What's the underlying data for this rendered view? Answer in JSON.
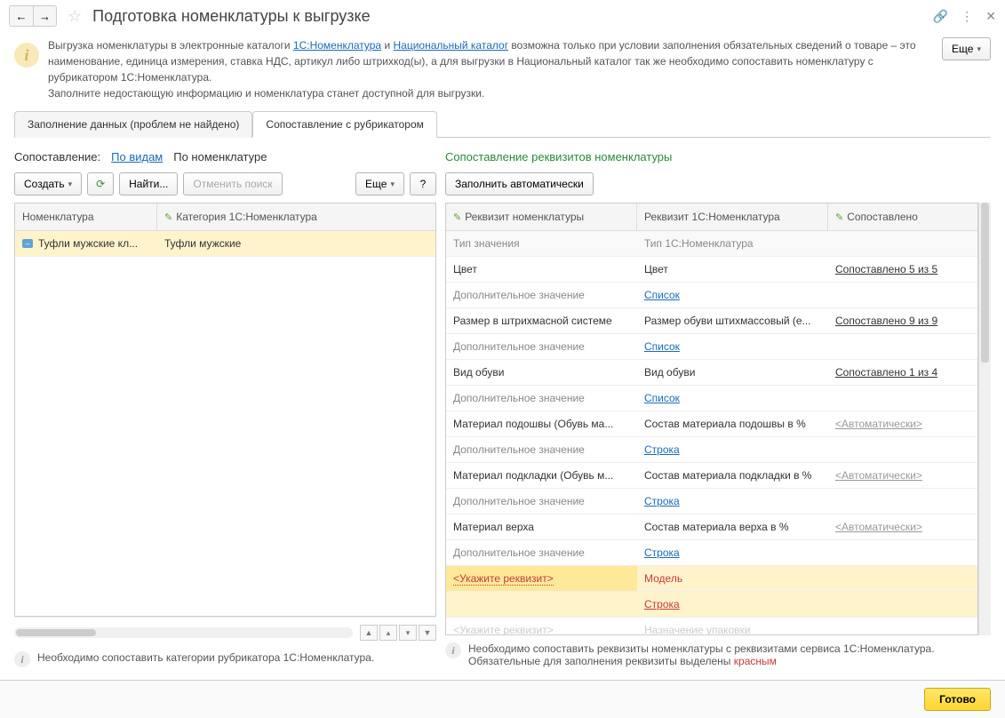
{
  "titlebar": {
    "title": "Подготовка номенклатуры к выгрузке"
  },
  "info": {
    "text_before_link1": "Выгрузка номенклатуры в электронные каталоги ",
    "link1": "1С:Номенклатура",
    "text_mid": " и ",
    "link2": "Национальный каталог",
    "text_after": " возможна только при условии заполнения обязательных сведений о товаре – это наименование, единица измерения, ставка НДС, артикул либо штрихкод(ы), а для выгрузки в Национальный каталог так же необходимо сопоставить номенклатуру с рубрикатором 1С:Номенклатура.",
    "line2": "Заполните недостающую информацию и номенклатура станет доступной для выгрузки."
  },
  "more_btn": "Еще",
  "tabs": {
    "tab1": "Заполнение данных (проблем не найдено)",
    "tab2": "Сопоставление с рубрикатором"
  },
  "left": {
    "filter_label": "Сопоставление:",
    "by_types": "По видам",
    "by_nomen": "По номенклатуре",
    "create_btn": "Создать",
    "find_btn": "Найти...",
    "cancel_search": "Отменить поиск",
    "more": "Еще",
    "help": "?",
    "header_col1": "Номенклатура",
    "header_col2": "Категория 1С:Номенклатура",
    "row1_name": "Туфли мужские кл...",
    "row1_cat": "Туфли мужские",
    "footer": "Необходимо сопоставить категории рубрикатора 1С:Номенклатура."
  },
  "right": {
    "title": "Сопоставление реквизитов номенклатуры",
    "auto_fill": "Заполнить автоматически",
    "h1": "Реквизит номенклатуры",
    "h2": "Реквизит 1С:Номенклатура",
    "h3": "Сопоставлено",
    "sub_h1": "Тип значения",
    "sub_h2": "Тип 1С:Номенклатура",
    "rows": [
      {
        "r1": "Цвет",
        "r2": "Цвет",
        "r3": "Сопоставлено 5 из 5",
        "s1": "Дополнительное значение",
        "s2": "Список",
        "link": true
      },
      {
        "r1": "Размер в штрихмасной системе",
        "r2": "Размер обуви штихмассовый (е...",
        "r3": "Сопоставлено 9 из 9",
        "s1": "Дополнительное значение",
        "s2": "Список",
        "link": true
      },
      {
        "r1": "Вид обуви",
        "r2": "Вид обуви",
        "r3": "Сопоставлено 1 из 4",
        "s1": "Дополнительное значение",
        "s2": "Список",
        "link": true
      },
      {
        "r1": "Материал подошвы (Обувь ма...",
        "r2": "Состав материала подошвы в %",
        "r3": "<Автоматически>",
        "s1": "Дополнительное значение",
        "s2": "Строка",
        "auto": true
      },
      {
        "r1": "Материал подкладки (Обувь м...",
        "r2": "Состав материала подкладки в %",
        "r3": "<Автоматически>",
        "s1": "Дополнительное значение",
        "s2": "Строка",
        "auto": true
      },
      {
        "r1": "Материал верха",
        "r2": "Состав материала верха в %",
        "r3": "<Автоматически>",
        "s1": "Дополнительное значение",
        "s2": "Строка",
        "auto": true
      }
    ],
    "empty_row": {
      "r1": "<Укажите реквизит>",
      "r2": "Модель",
      "s2": "Строка"
    },
    "last_hint": {
      "r1": "<Укажите реквизит>",
      "r2": "Назначение упаковки"
    },
    "footer_text": "Необходимо сопоставить реквизиты номенклатуры с реквизитами сервиса 1С:Номенклатура. Обязательные для заполнения реквизиты выделены ",
    "footer_red": "красным"
  },
  "done_btn": "Готово"
}
